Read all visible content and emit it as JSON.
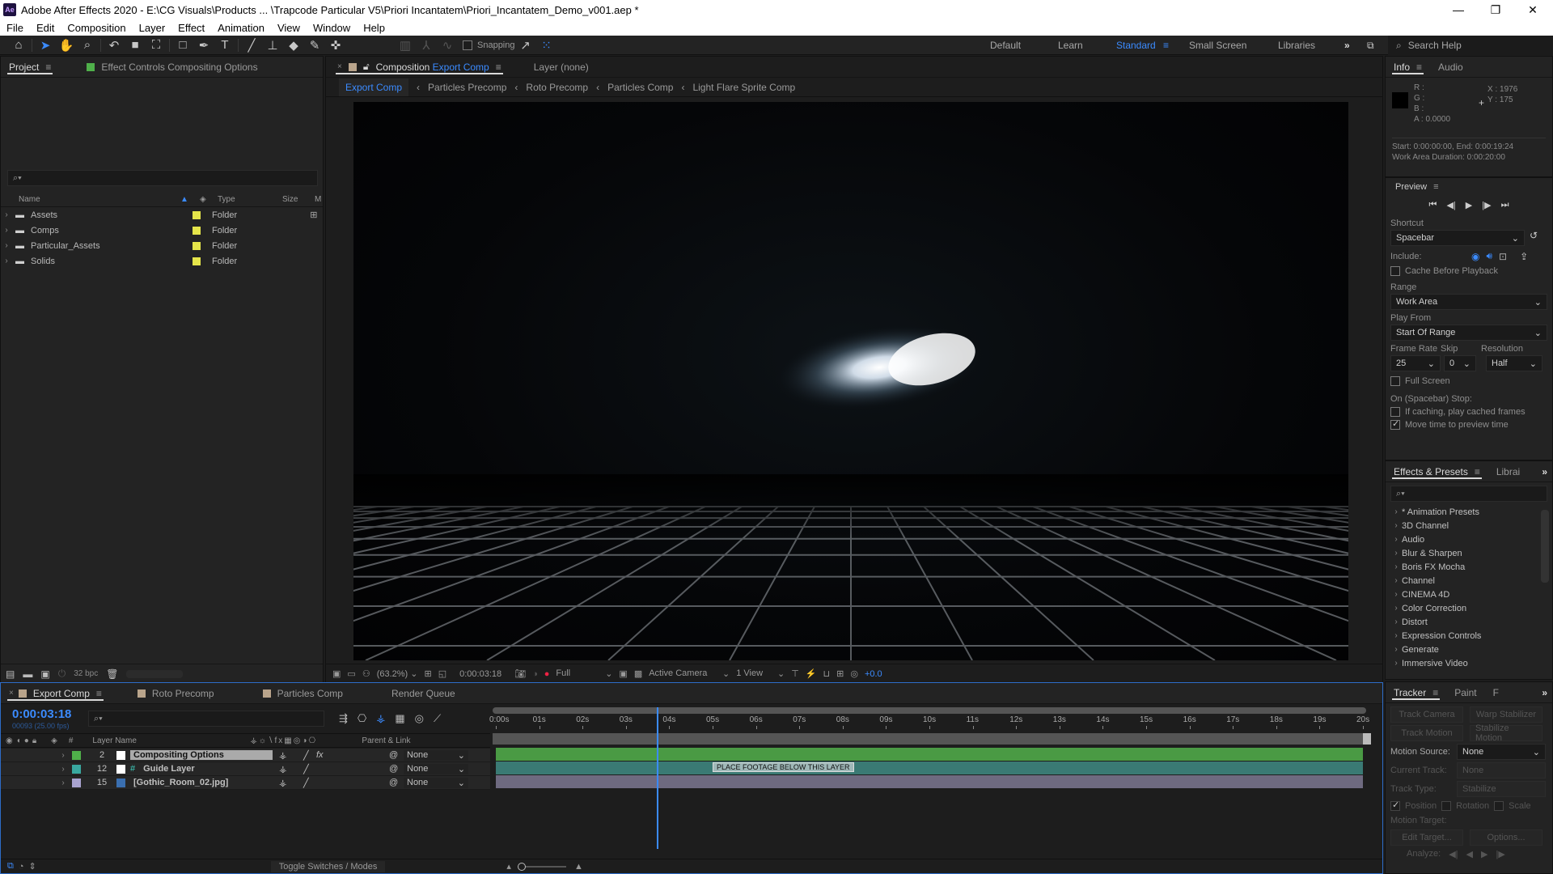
{
  "window": {
    "app_icon": "Ae",
    "title": "Adobe After Effects 2020 - E:\\CG Visuals\\Products ... \\Trapcode Particular V5\\Priori Incantatem\\Priori_Incantatem_Demo_v001.aep *",
    "minimize": "—",
    "restore": "❐",
    "close": "✕"
  },
  "menu": [
    "File",
    "Edit",
    "Composition",
    "Layer",
    "Effect",
    "Animation",
    "View",
    "Window",
    "Help"
  ],
  "toolbar": {
    "snapping_label": "Snapping",
    "workspaces": [
      "Default",
      "Learn",
      "Standard",
      "Small Screen",
      "Libraries"
    ],
    "active_workspace": "Standard",
    "search_help_placeholder": "Search Help",
    "accent_color": "#3b8bff"
  },
  "project_panel": {
    "tab_label": "Project",
    "effect_controls_label": "Effect Controls Compositing Options",
    "columns": {
      "name": "Name",
      "type": "Type",
      "size": "Size",
      "media": "M"
    },
    "items": [
      {
        "name": "Assets",
        "type": "Folder"
      },
      {
        "name": "Comps",
        "type": "Folder"
      },
      {
        "name": "Particular_Assets",
        "type": "Folder"
      },
      {
        "name": "Solids",
        "type": "Folder"
      }
    ],
    "bpc_label": "32 bpc"
  },
  "composition_panel": {
    "tab_prefix": "Composition",
    "tab_comp": "Export Comp",
    "layer_tab": "Layer (none)",
    "breadcrumbs": [
      "Export Comp",
      "Particles Precomp",
      "Roto Precomp",
      "Particles Comp",
      "Light Flare Sprite Comp"
    ],
    "zoom": "(63.2%)",
    "timecode": "0:00:03:18",
    "resolution": "Full",
    "camera": "Active Camera",
    "views": "1 View",
    "exposure": "+0.0"
  },
  "info_panel": {
    "tabs": [
      "Info",
      "Audio"
    ],
    "r": "R :",
    "g": "G :",
    "b": "B :",
    "a": "A :  0.0000",
    "x": "X : 1976",
    "y": "Y : 175",
    "start_end": "Start: 0:00:00:00, End: 0:00:19:24",
    "work_area": "Work Area Duration: 0:00:20:00"
  },
  "preview_panel": {
    "title": "Preview",
    "shortcut_label": "Shortcut",
    "shortcut_value": "Spacebar",
    "include_label": "Include:",
    "cache_before_playback": "Cache Before Playback",
    "range_label": "Range",
    "range_value": "Work Area",
    "play_from_label": "Play From",
    "play_from_value": "Start Of Range",
    "frame_rate_label": "Frame Rate",
    "frame_rate_value": "25",
    "skip_label": "Skip",
    "skip_value": "0",
    "resolution_label": "Resolution",
    "resolution_value": "Half",
    "full_screen": "Full Screen",
    "on_stop_label": "On (Spacebar) Stop:",
    "if_caching": "If caching, play cached frames",
    "move_time": "Move time to preview time"
  },
  "effects_panel": {
    "tabs": [
      "Effects & Presets",
      "Librai"
    ],
    "items": [
      "* Animation Presets",
      "3D Channel",
      "Audio",
      "Blur & Sharpen",
      "Boris FX Mocha",
      "Channel",
      "CINEMA 4D",
      "Color Correction",
      "Distort",
      "Expression Controls",
      "Generate",
      "Immersive Video"
    ]
  },
  "tracker_panel": {
    "tabs": [
      "Tracker",
      "Paint",
      "F"
    ],
    "track_camera": "Track Camera",
    "warp_stabilizer": "Warp Stabilizer",
    "track_motion": "Track Motion",
    "stabilize_motion": "Stabilize Motion",
    "motion_source_label": "Motion Source:",
    "motion_source_value": "None",
    "current_track_label": "Current Track:",
    "current_track_value": "None",
    "track_type_label": "Track Type:",
    "track_type_value": "Stabilize",
    "position": "Position",
    "rotation": "Rotation",
    "scale": "Scale",
    "motion_target": "Motion Target:",
    "edit_target": "Edit Target...",
    "options": "Options...",
    "analyze": "Analyze:"
  },
  "timeline": {
    "tabs": [
      {
        "label": "Export Comp",
        "color": "#b9a48b"
      },
      {
        "label": "Roto Precomp",
        "color": "#b9a48b"
      },
      {
        "label": "Particles Comp",
        "color": "#b9a48b"
      },
      {
        "label": "Render Queue",
        "color": ""
      }
    ],
    "timecode": "0:00:03:18",
    "frame_info": "00093 (25.00 fps)",
    "col_layer_name": "Layer Name",
    "col_parent": "Parent & Link",
    "col_num": "#",
    "ruler": [
      "0:00s",
      "01s",
      "02s",
      "03s",
      "04s",
      "05s",
      "06s",
      "07s",
      "08s",
      "09s",
      "10s",
      "11s",
      "12s",
      "13s",
      "14s",
      "15s",
      "16s",
      "17s",
      "18s",
      "19s",
      "20s"
    ],
    "current_time_s": 3.72,
    "duration_s": 20,
    "layers": [
      {
        "num": "2",
        "name": "Compositing Options",
        "label_color": "#4fb04a",
        "bar_color": "#4a9a44",
        "parent": "None",
        "fx": true,
        "type": "solid"
      },
      {
        "num": "12",
        "name": "Guide Layer",
        "label_color": "#39a8a0",
        "bar_color": "#3a7a74",
        "parent": "None",
        "fx": false,
        "type": "guide",
        "marker": "PLACE FOOTAGE BELOW THIS LAYER",
        "marker_s": 5.0
      },
      {
        "num": "15",
        "name": "[Gothic_Room_02.jpg]",
        "label_color": "#a9a3d0",
        "bar_color": "#6e6a80",
        "parent": "None",
        "fx": false,
        "type": "image"
      }
    ],
    "toggle_label": "Toggle Switches / Modes"
  }
}
